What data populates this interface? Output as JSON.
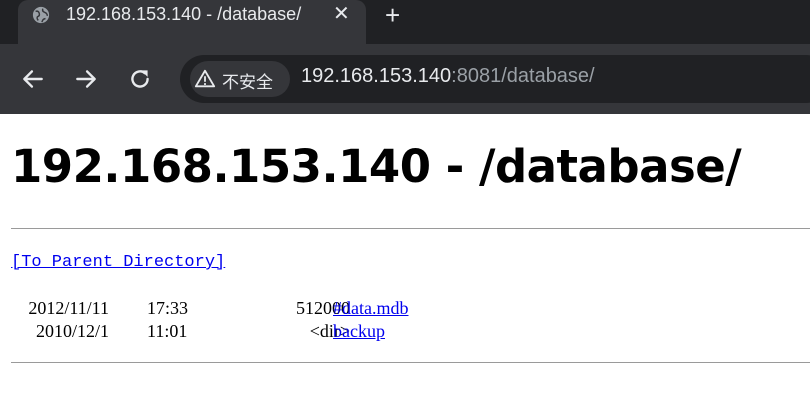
{
  "browser": {
    "tab": {
      "title": "192.168.153.140 - /database/",
      "close_glyph": "✕"
    },
    "new_tab_glyph": "+",
    "omnibox": {
      "security_label": "不安全",
      "url_host": "192.168.153.140",
      "url_rest": ":8081/database/"
    }
  },
  "page": {
    "title": "192.168.153.140 - /database/",
    "parent_link": "[To Parent Directory]",
    "entries": [
      {
        "date": "2012/11/11",
        "time": "17:33",
        "size": "512000",
        "name": "#data.mdb"
      },
      {
        "date": "2010/12/1",
        "time": "11:01",
        "size": "<dir>",
        "name": "backup"
      }
    ]
  },
  "colors": {
    "tabstrip": "#202124",
    "toolbar": "#35363a",
    "link": "#0000ee"
  }
}
